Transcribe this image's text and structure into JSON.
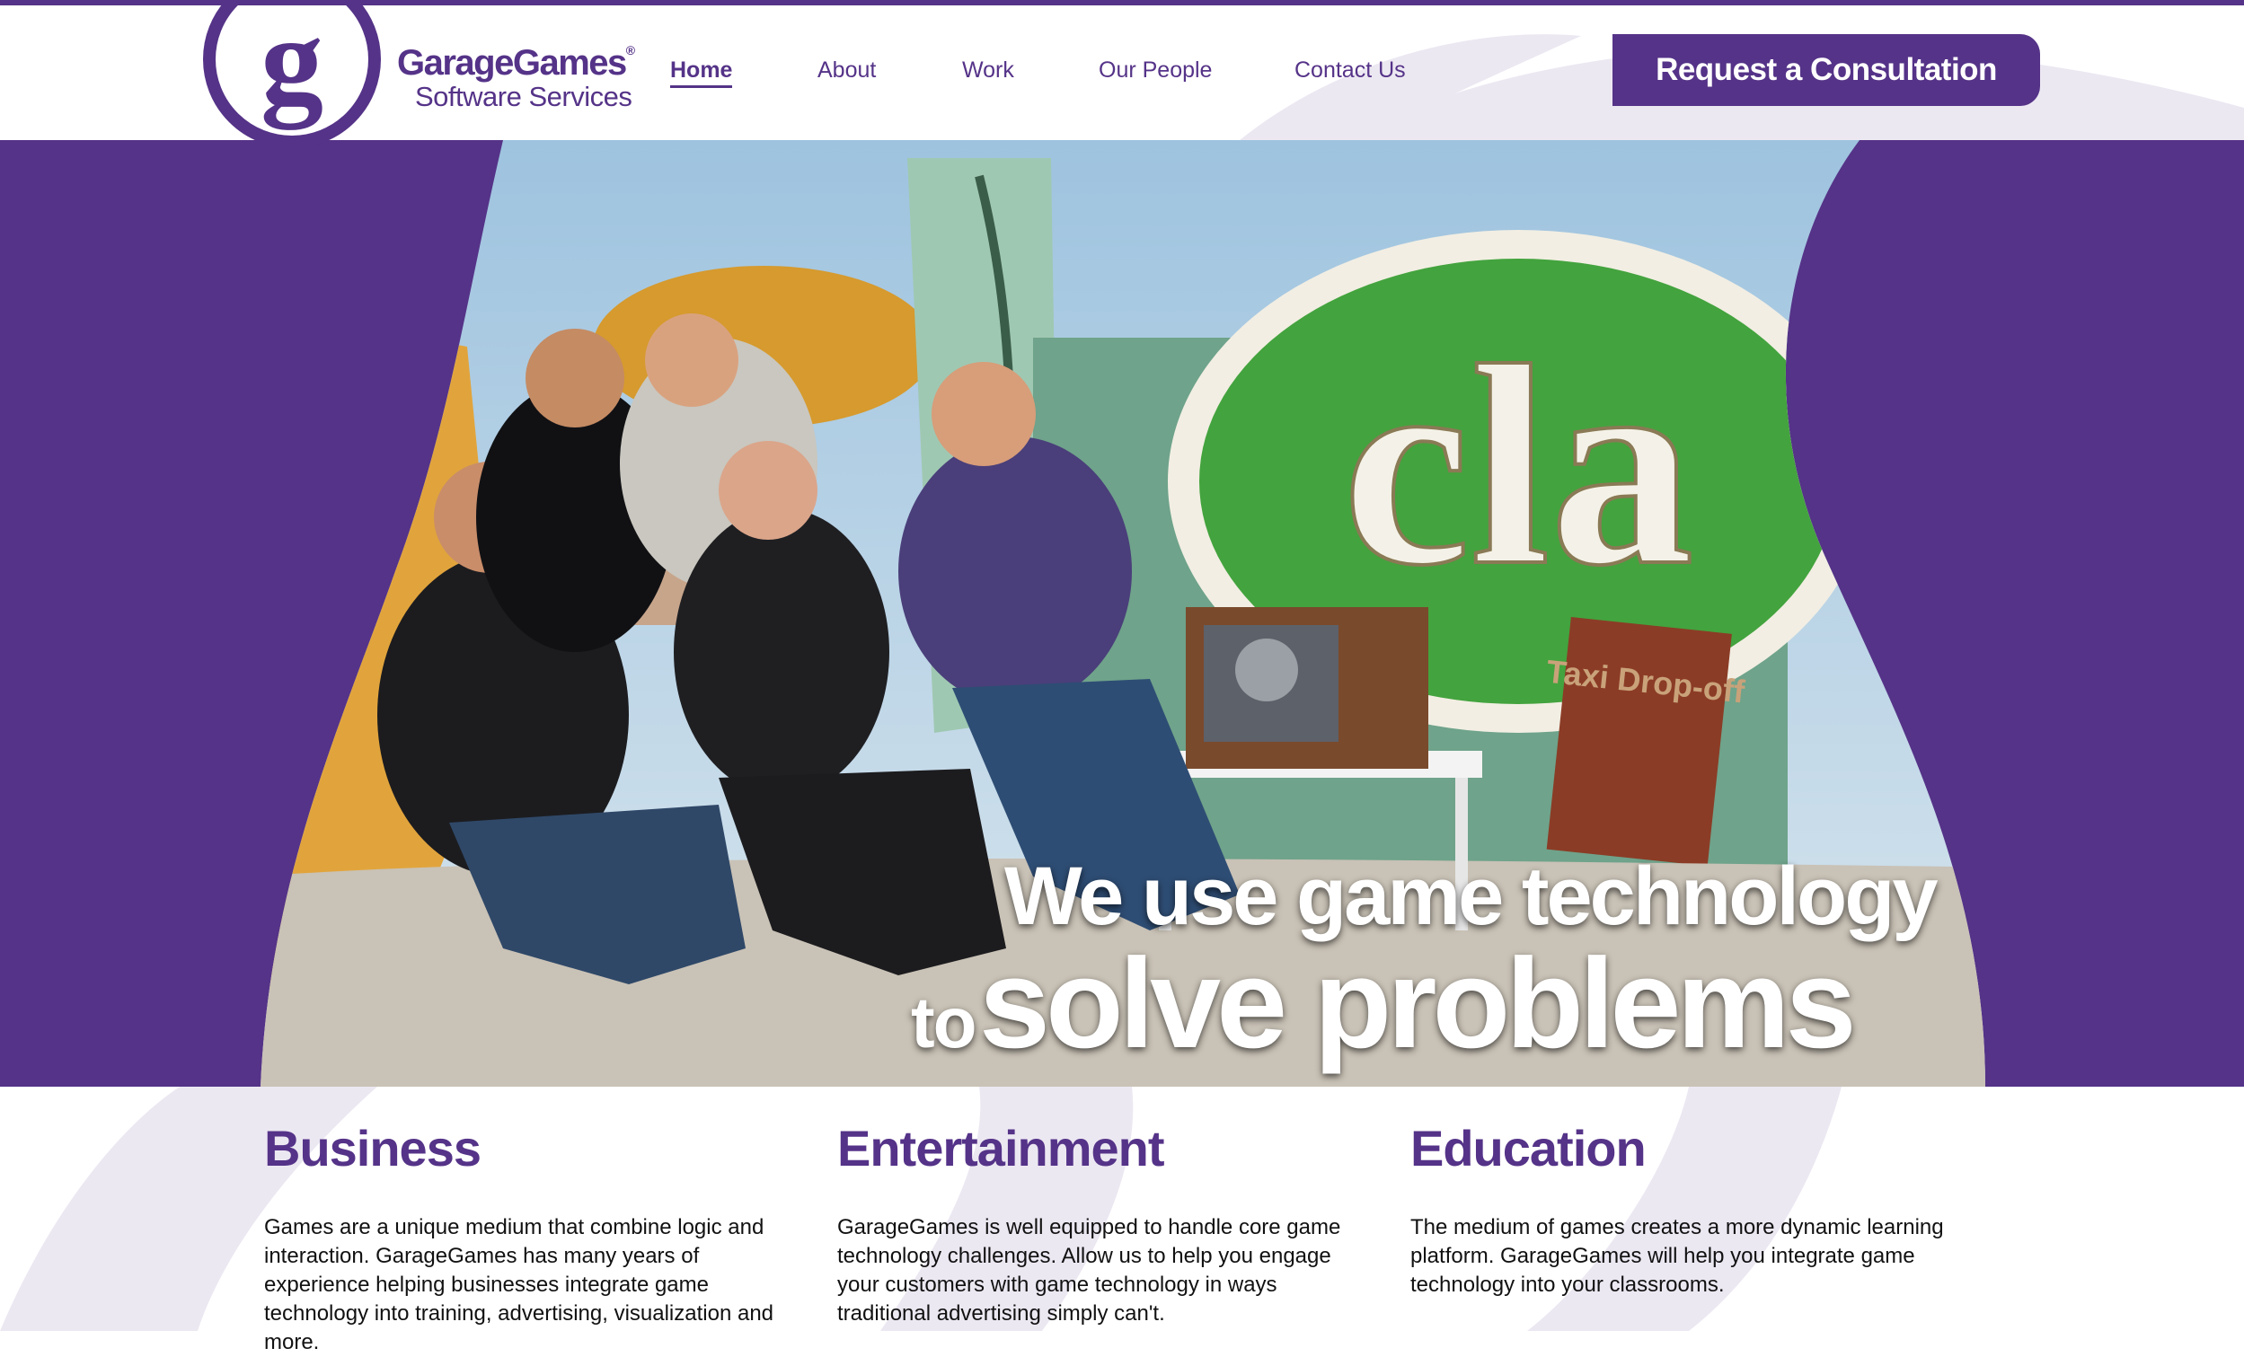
{
  "brand": {
    "name": "GarageGames",
    "sub": "Software Services",
    "reg": "®",
    "mark_letter": "g",
    "color": "#553388"
  },
  "nav": {
    "items": [
      {
        "label": "Home",
        "active": true
      },
      {
        "label": "About",
        "active": false
      },
      {
        "label": "Work",
        "active": false
      },
      {
        "label": "Our People",
        "active": false
      },
      {
        "label": "Contact Us",
        "active": false
      }
    ]
  },
  "cta": {
    "label": "Request a Consultation"
  },
  "hero": {
    "line1": "We use game technology",
    "line2_small": "to",
    "line2_big": "solve problems",
    "sign_text": "cla",
    "sign2_text": "Taxi Drop-off"
  },
  "columns": [
    {
      "title": "Business",
      "text": "Games are a unique medium that combine logic and interaction. GarageGames has many years of experience helping businesses integrate game technology into training, advertising, visualization and more."
    },
    {
      "title": "Entertainment",
      "text": "GarageGames is well equipped to handle core game technology challenges. Allow us to help you engage your customers with game technology in ways traditional advertising simply can't."
    },
    {
      "title": "Education",
      "text": "The medium of games creates a more dynamic learning platform. GarageGames will help you integrate game technology into your classrooms."
    }
  ]
}
